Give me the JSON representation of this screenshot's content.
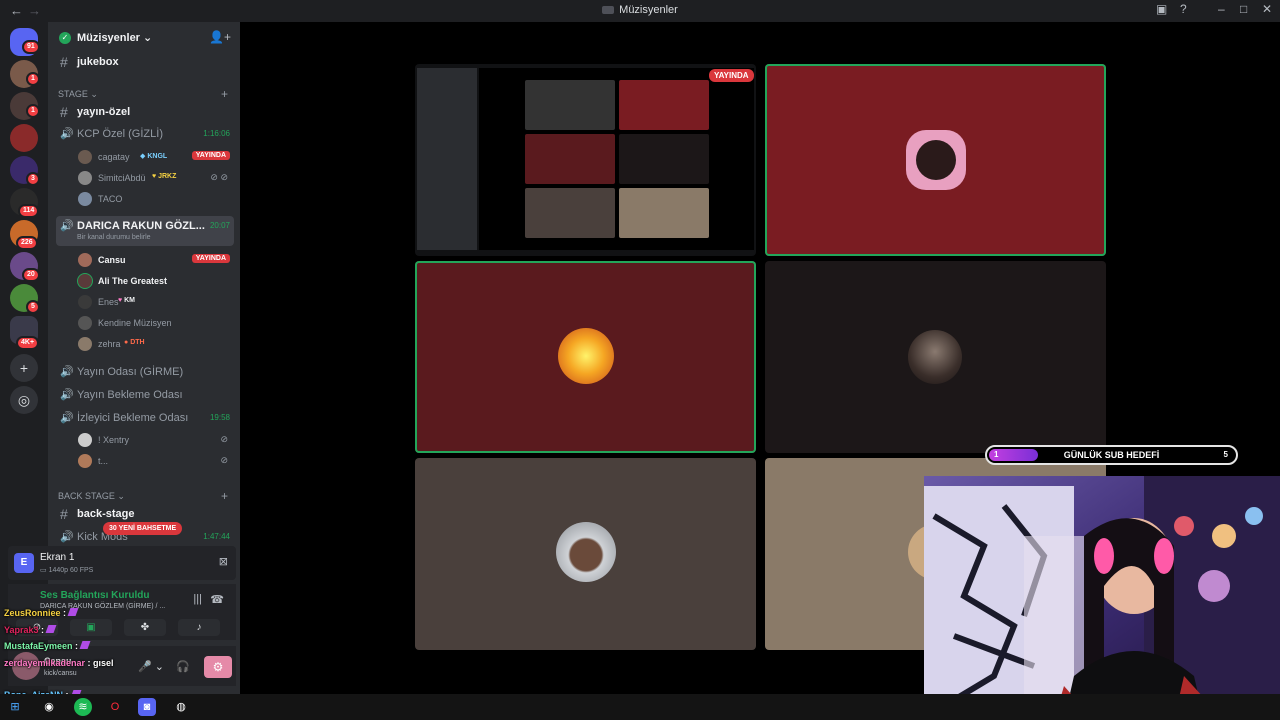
{
  "window": {
    "title": "Müzisyenler",
    "nav_back": "←",
    "nav_forward": "→"
  },
  "rail": {
    "badges": [
      "91",
      "1",
      "1",
      "3",
      "114",
      "226",
      "20",
      "5",
      "4K+"
    ]
  },
  "server": {
    "name": "Müzisyenler"
  },
  "channels": {
    "jukebox": "jukebox",
    "stage_category": "STAGE",
    "yayin_ozel": "yayın-özel",
    "kcp": {
      "name": "KCP Özel (GİZLİ)",
      "time": "1:16:06"
    },
    "kcp_users": [
      {
        "name": "cagatay",
        "tag": "KNGL",
        "live": "YAYINDA"
      },
      {
        "name": "SimitciAbdü",
        "tag": "JRKZ"
      },
      {
        "name": "TACO"
      }
    ],
    "darica": {
      "name": "DARICA RAKUN GÖZL...",
      "time": "20:07",
      "status": "Bir kanal durumu belirle"
    },
    "darica_users": [
      {
        "name": "Cansu",
        "live": "YAYINDA"
      },
      {
        "name": "Ali The Greatest"
      },
      {
        "name": "Enes",
        "tag": "KM"
      },
      {
        "name": "Kendine Müzisyen"
      },
      {
        "name": "zehra",
        "tag": "DTH"
      }
    ],
    "yayin_odasi": "Yayın Odası (GİRME)",
    "yayin_bekleme": "Yayın Bekleme Odası",
    "izleyici": {
      "name": "İzleyici Bekleme Odası",
      "time": "19:58"
    },
    "izleyici_users": [
      {
        "name": "! Xentry"
      },
      {
        "name": "t..."
      }
    ],
    "backstage_category": "BACK STAGE",
    "back_stage": "back-stage",
    "kick_mods": {
      "name": "Kick Mods",
      "time": "1:47:44"
    },
    "new_mentions": "30 YENİ BAHSETME"
  },
  "screen_panel": {
    "title": "Ekran 1",
    "quality": "1440p 60 FPS",
    "icon_letter": "E"
  },
  "voice_panel": {
    "status": "Ses Bağlantısı Kuruldu",
    "channel": "DARICA RAKUN GÖZLEM (GİRME) / ..."
  },
  "user_panel": {
    "name": "Cansu",
    "status": "kick/cansu"
  },
  "chat": [
    {
      "user": "ZeusRonniee",
      "color": "#f5d142",
      "msg": ""
    },
    {
      "user": "Yaprak3",
      "color": "#e0245e",
      "msg": ""
    },
    {
      "user": "MustafaEymeen",
      "color": "#7cf5a8",
      "msg": ""
    },
    {
      "user": "zerdayemilkadenar",
      "color": "#ff7ac6",
      "msg": "gısel"
    },
    {
      "user": "Bone_AizeNN",
      "color": "#66c7ff",
      "msg": ""
    }
  ],
  "stage": {
    "live_label": "YAYINDA"
  },
  "sub_goal": {
    "label": "GÜNLÜK SUB HEDEFİ",
    "current": "1",
    "target": "5",
    "progress": 0.2
  },
  "colors": {
    "live": "#da373c",
    "speaking": "#23a55a",
    "tile_red": "#7a1c22",
    "tile_dark": "#1c1718",
    "tile_brown": "#4a403c",
    "tile_tan": "#8a7a68"
  }
}
